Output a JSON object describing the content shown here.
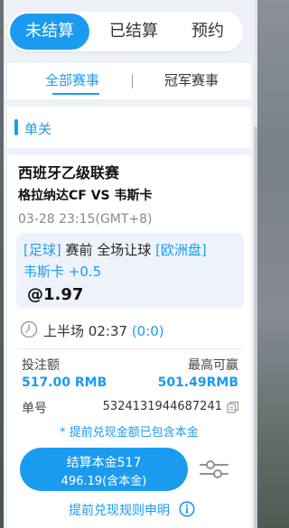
{
  "tabs": {
    "items": [
      {
        "label": "未结算",
        "active": true
      },
      {
        "label": "已结算",
        "active": false
      },
      {
        "label": "预约",
        "active": false
      }
    ]
  },
  "subtabs": {
    "all": "全部赛事",
    "champion": "冠军赛事"
  },
  "bet": {
    "type_label": "单关",
    "league": "西班牙乙级联赛",
    "match": "格拉纳达CF VS 韦斯卡",
    "datetime": "03-28 23:15(GMT+8)",
    "sport": "[足球]",
    "market": "赛前 全场让球",
    "odds_type": "[欧洲盘]",
    "selection": "韦斯卡 +0.5",
    "odds": "@1.97",
    "period": "上半场",
    "clock": "02:37",
    "score": "(0:0)",
    "stake_label": "投注额",
    "stake_value": "517.00 RMB",
    "max_win_label": "最高可赢",
    "max_win_value": "501.49RMB",
    "order_label": "单号",
    "order_value": "5324131944687241",
    "cashout_note": "* 提前兑现金额已包含本金",
    "cashout_line1": "结算本金517",
    "cashout_line2": "496.19(含本金)",
    "rules_link": "提前兑现规则申明"
  },
  "colors": {
    "accent": "#1b9bf0",
    "background": "#eef2f8"
  }
}
